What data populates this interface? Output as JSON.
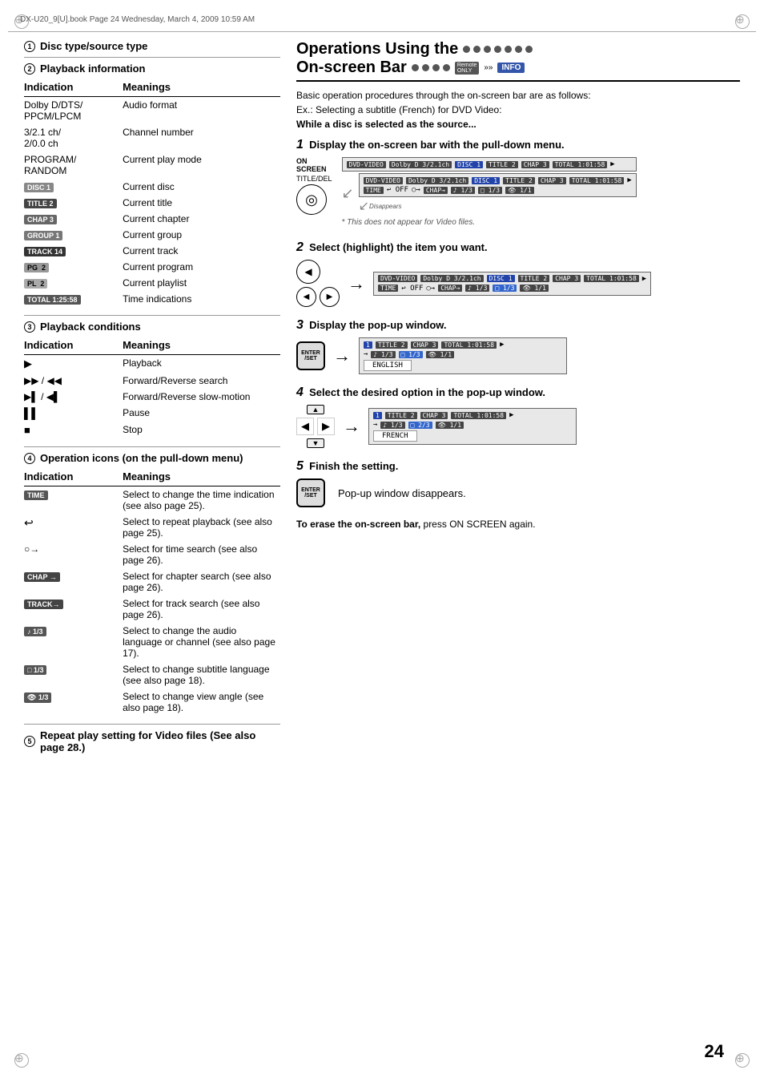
{
  "page": {
    "number": "24",
    "header": "DX-U20_9[U].book  Page 24  Wednesday, March 4, 2009  10:59 AM"
  },
  "left": {
    "sections": [
      {
        "num": "1",
        "title": "Disc type/source type"
      },
      {
        "num": "2",
        "title": "Playback information",
        "table_headers": [
          "Indication",
          "Meanings"
        ],
        "rows": [
          {
            "ind": "Dolby D/DTS/PPCM/LPCM",
            "mean": "Audio format",
            "type": "text"
          },
          {
            "ind": "3/2.1 ch/ 2/0.0 ch",
            "mean": "Channel number",
            "type": "text"
          },
          {
            "ind": "PROGRAM/RANDOM",
            "mean": "Current play mode",
            "type": "text"
          },
          {
            "ind": "DISC 1",
            "mean": "Current disc",
            "type": "badge",
            "badge_label": "DISC 1"
          },
          {
            "ind": "TITLE 2",
            "mean": "Current title",
            "type": "badge",
            "badge_label": "TITLE 2"
          },
          {
            "ind": "CHAP 3",
            "mean": "Current chapter",
            "type": "badge",
            "badge_label": "CHAP 3"
          },
          {
            "ind": "GROUP 1",
            "mean": "Current group",
            "type": "badge",
            "badge_label": "GROUP 1"
          },
          {
            "ind": "TRACK 14",
            "mean": "Current track",
            "type": "badge",
            "badge_label": "TRACK 14"
          },
          {
            "ind": "PG  2",
            "mean": "Current program",
            "type": "badge",
            "badge_label": "PG  2"
          },
          {
            "ind": "PL  2",
            "mean": "Current playlist",
            "type": "badge",
            "badge_label": "PL  2"
          },
          {
            "ind": "TOTAL 1:25:58",
            "mean": "Time indications",
            "type": "badge",
            "badge_label": "TOTAL 1:25:58"
          }
        ]
      },
      {
        "num": "3",
        "title": "Playback conditions",
        "table_headers": [
          "Indication",
          "Meanings"
        ],
        "rows": [
          {
            "ind": "▶",
            "mean": "Playback",
            "type": "icon"
          },
          {
            "ind": "▶▶/◀◀",
            "mean": "Forward/Reverse search",
            "type": "icon"
          },
          {
            "ind": "▶▌/◀▌",
            "mean": "Forward/Reverse slow-motion",
            "type": "icon"
          },
          {
            "ind": "▌▌",
            "mean": "Pause",
            "type": "icon"
          },
          {
            "ind": "■",
            "mean": "Stop",
            "type": "icon"
          }
        ]
      },
      {
        "num": "4",
        "title": "Operation icons (on the pull-down menu)",
        "table_headers": [
          "Indication",
          "Meanings"
        ],
        "rows": [
          {
            "ind": "TIME",
            "mean": "Select to change the time indication (see also page 25).",
            "type": "badge",
            "badge_label": "TIME"
          },
          {
            "ind": "↩",
            "mean": "Select to repeat playback (see also page 25).",
            "type": "icon"
          },
          {
            "ind": "○→",
            "mean": "Select for time search (see also page 26).",
            "type": "icon"
          },
          {
            "ind": "CHAP →",
            "mean": "Select for chapter search (see also page 26).",
            "type": "badge",
            "badge_label": "CHAP →"
          },
          {
            "ind": "TRACK →",
            "mean": "Select for track search (see also page 26).",
            "type": "badge",
            "badge_label": "TRACK→"
          },
          {
            "ind": "🎵 1/3",
            "mean": "Select to change the audio language or channel (see also page 17).",
            "type": "badge",
            "badge_label": "♪ 1/3"
          },
          {
            "ind": "□ 1/3",
            "mean": "Select to change subtitle language (see also page 18).",
            "type": "badge",
            "badge_label": "□ 1/3"
          },
          {
            "ind": "⛶ 1/3",
            "mean": "Select to change view angle (see also page 18).",
            "type": "badge",
            "badge_label": "👁 1/3"
          }
        ]
      },
      {
        "num": "5",
        "title": "Repeat play setting for Video files",
        "suffix": "(See also page 28.)"
      }
    ]
  },
  "right": {
    "title_line1": "Operations Using the",
    "title_line2": "On-screen Bar",
    "intro": "Basic operation procedures through the on-screen bar are as follows:",
    "example": "Ex.: Selecting a subtitle (French) for DVD Video:",
    "example_bold": "While a disc is selected as the source...",
    "steps": [
      {
        "num": "1",
        "instruction": "Display the on-screen bar with the pull-down menu.",
        "screen_label": "ON SCREEN",
        "screen_label2": "TITLE/DEL",
        "screen_rows": [
          "DVD-VIDEO  Dolby D 3/2.1ch   DISC 1  TITLE 2  CHAP 3  TOTAL 1:01:58 ▶",
          "DVD-VIDEO  Dolby D 3/2.1ch   DISC 1  TITLE 2  CHAP 3  TOTAL 1:01:58 ▶",
          "TIME  ↩ OFF  ○→  CHAP→  ♪ 1/3  □ 1/3  👁 1/1"
        ],
        "disappears": "Disappears",
        "note": "* This does not appear for Video files."
      },
      {
        "num": "2",
        "instruction": "Select (highlight) the item you want.",
        "screen_rows": [
          "DVD-VIDEO  Dolby D 3/2.1ch   DISC 1  TITLE 2  CHAP 3  TOTAL 1:01:58 ▶",
          "TIME  ↩ OFF  ○→  CHAP→  ♪ 1/3  □ 1/3  👁 1/1"
        ]
      },
      {
        "num": "3",
        "instruction": "Display the pop-up window.",
        "screen_rows": [
          "1  TITLE 2  CHAP 3  TOTAL 1:01:58 ▶",
          "→ ♪ 1/3  □ 1/3  👁 1/1",
          "ENGLISH"
        ]
      },
      {
        "num": "4",
        "instruction": "Select the desired option in the pop-up window.",
        "screen_rows": [
          "1  TITLE 2  CHAP 3  TOTAL 1:01:58 ▶",
          "→ ♪ 1/3  □ 2/3  👁 1/1",
          "FRENCH"
        ]
      },
      {
        "num": "5",
        "instruction": "Finish the setting.",
        "note2": "Pop-up window disappears."
      }
    ],
    "footer": "To erase the on-screen bar, press ON SCREEN again."
  }
}
